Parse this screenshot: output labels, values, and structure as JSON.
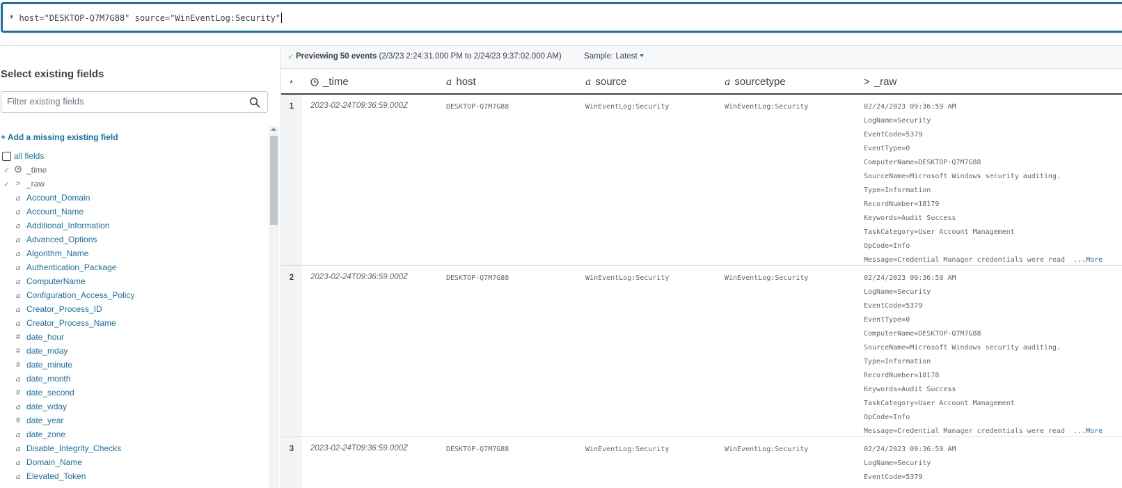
{
  "search": {
    "query": "* host=\"DESKTOP-Q7M7G88\" source=\"WinEventLog:Security\""
  },
  "left": {
    "title": "Select existing fields",
    "filter_placeholder": "Filter existing fields",
    "add_link": "+ Add a missing existing field",
    "all_fields": "all fields",
    "fields": [
      {
        "name": "_time",
        "type": "clock",
        "selected": true
      },
      {
        "name": "_raw",
        "type": ">",
        "selected": true
      },
      {
        "name": "Account_Domain",
        "type": "a"
      },
      {
        "name": "Account_Name",
        "type": "a"
      },
      {
        "name": "Additional_Information",
        "type": "a"
      },
      {
        "name": "Advanced_Options",
        "type": "a"
      },
      {
        "name": "Algorithm_Name",
        "type": "a"
      },
      {
        "name": "Authentication_Package",
        "type": "a"
      },
      {
        "name": "ComputerName",
        "type": "a"
      },
      {
        "name": "Configuration_Access_Policy",
        "type": "a"
      },
      {
        "name": "Creator_Process_ID",
        "type": "a"
      },
      {
        "name": "Creator_Process_Name",
        "type": "a"
      },
      {
        "name": "date_hour",
        "type": "#"
      },
      {
        "name": "date_mday",
        "type": "#"
      },
      {
        "name": "date_minute",
        "type": "#"
      },
      {
        "name": "date_month",
        "type": "a"
      },
      {
        "name": "date_second",
        "type": "#"
      },
      {
        "name": "date_wday",
        "type": "a"
      },
      {
        "name": "date_year",
        "type": "#"
      },
      {
        "name": "date_zone",
        "type": "a"
      },
      {
        "name": "Disable_Integrity_Checks",
        "type": "a"
      },
      {
        "name": "Domain_Name",
        "type": "a"
      },
      {
        "name": "Elevated_Token",
        "type": "a"
      }
    ]
  },
  "preview": {
    "bold": "Previewing 50 events",
    "range": " (2/3/23 2:24:31.000 PM to 2/24/23 9:37:02.000 AM)",
    "sample": "Sample: Latest"
  },
  "table": {
    "columns": {
      "star": "*",
      "time": "_time",
      "host": "host",
      "source": "source",
      "sourcetype": "sourcetype",
      "raw": "_raw"
    },
    "more_label": "...More",
    "rows": [
      {
        "idx": "1",
        "time": "2023-02-24T09:36:59.000Z",
        "host": "DESKTOP-Q7M7G88",
        "source": "WinEventLog:Security",
        "sourcetype": "WinEventLog:Security",
        "raw": [
          "02/24/2023 09:36:59 AM",
          "LogName=Security",
          "EventCode=5379",
          "EventType=0",
          "ComputerName=DESKTOP-Q7M7G88",
          "SourceName=Microsoft Windows security auditing.",
          "Type=Information",
          "RecordNumber=18179",
          "Keywords=Audit Success",
          "TaskCategory=User Account Management",
          "OpCode=Info",
          "Message=Credential Manager credentials were read  "
        ]
      },
      {
        "idx": "2",
        "time": "2023-02-24T09:36:59.000Z",
        "host": "DESKTOP-Q7M7G88",
        "source": "WinEventLog:Security",
        "sourcetype": "WinEventLog:Security",
        "raw": [
          "02/24/2023 09:36:59 AM",
          "LogName=Security",
          "EventCode=5379",
          "EventType=0",
          "ComputerName=DESKTOP-Q7M7G88",
          "SourceName=Microsoft Windows security auditing.",
          "Type=Information",
          "RecordNumber=18178",
          "Keywords=Audit Success",
          "TaskCategory=User Account Management",
          "OpCode=Info",
          "Message=Credential Manager credentials were read  "
        ]
      },
      {
        "idx": "3",
        "time": "2023-02-24T09:36:59.000Z",
        "host": "DESKTOP-Q7M7G88",
        "source": "WinEventLog:Security",
        "sourcetype": "WinEventLog:Security",
        "raw": [
          "02/24/2023 09:36:59 AM",
          "LogName=Security",
          "EventCode=5379"
        ]
      }
    ]
  }
}
